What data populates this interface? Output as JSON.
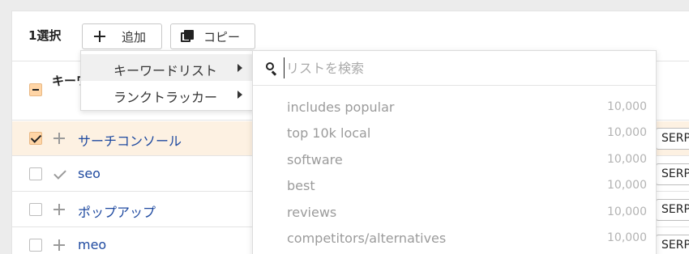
{
  "toolbar": {
    "selection_count": "1選択",
    "add_label": "追加",
    "copy_label": "コピー"
  },
  "table_header": {
    "label": "キーワード"
  },
  "rows": [
    {
      "keyword": "サーチコンソール",
      "checked": true,
      "action": "plus",
      "serp": "SERP"
    },
    {
      "keyword": "seo",
      "checked": false,
      "action": "check",
      "serp": "SERP"
    },
    {
      "keyword": "ポップアップ",
      "checked": false,
      "action": "plus",
      "serp": "SERP"
    },
    {
      "keyword": "meo",
      "checked": false,
      "action": "plus",
      "serp": "SERP"
    }
  ],
  "add_menu": {
    "items": [
      {
        "label": "キーワードリスト",
        "active": true
      },
      {
        "label": "ランクトラッカー",
        "active": false
      }
    ]
  },
  "list_panel": {
    "search_placeholder": "リストを検索",
    "options": [
      {
        "name": "includes popular",
        "count": "10,000"
      },
      {
        "name": "top 10k local",
        "count": "10,000"
      },
      {
        "name": "software",
        "count": "10,000"
      },
      {
        "name": "best",
        "count": "10,000"
      },
      {
        "name": "reviews",
        "count": "10,000"
      },
      {
        "name": "competitors/alternatives",
        "count": "10,000"
      }
    ]
  },
  "colors": {
    "accent_checkbox": "#ffd5a6",
    "selected_row_bg": "#fdf1e2",
    "keyword_link": "#1f4aa0"
  }
}
